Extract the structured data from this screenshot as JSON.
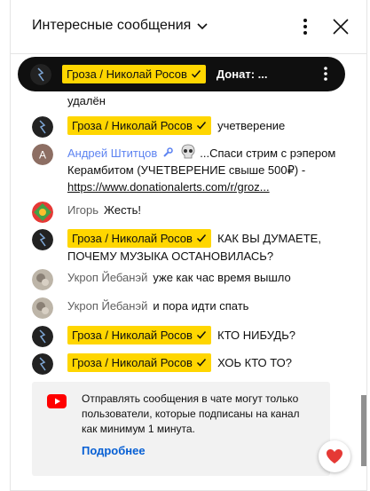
{
  "header": {
    "title": "Интересные сообщения"
  },
  "pinned": {
    "author": "Гроза / Николай Росов",
    "text": "Донат: ..."
  },
  "messages": [
    {
      "text": "удалён"
    },
    {
      "author": "Гроза / Николай Росов",
      "text": "учетверение"
    },
    {
      "author": "Андрей Штитцов",
      "avatar_letter": "А",
      "text": "...Спаси стрим с рэпером Керамбитом (УЧЕТВЕРЕНИЕ свыше 500₽) - ",
      "link": "https://www.donationalerts.com/r/groz..."
    },
    {
      "author": "Игорь",
      "text": "Жесть!"
    },
    {
      "author": "Гроза / Николай Росов",
      "text": "КАК ВЫ ДУМАЕТЕ, ПОЧЕМУ МУЗЫКА ОСТАНОВИЛАСЬ?"
    },
    {
      "author": "Укроп Йебанэй",
      "text": "уже как час время вышло"
    },
    {
      "author": "Укроп Йебанэй",
      "text": "и пора идти спать"
    },
    {
      "author": "Гроза / Николай Росов",
      "text": "КТО НИБУДЬ?"
    },
    {
      "author": "Гроза / Николай Росов",
      "text": "ХОЬ КТО ТО?"
    }
  ],
  "notice": {
    "text": "Отправлять сообщения в чате могут только пользователи, которые подписаны на канал как минимум 1 минута.",
    "link": "Подробнее"
  },
  "colors": {
    "badge": "#ffd600",
    "moderator": "#5e84f1",
    "link": "#065fd4",
    "youtube_red": "#ff0000"
  }
}
